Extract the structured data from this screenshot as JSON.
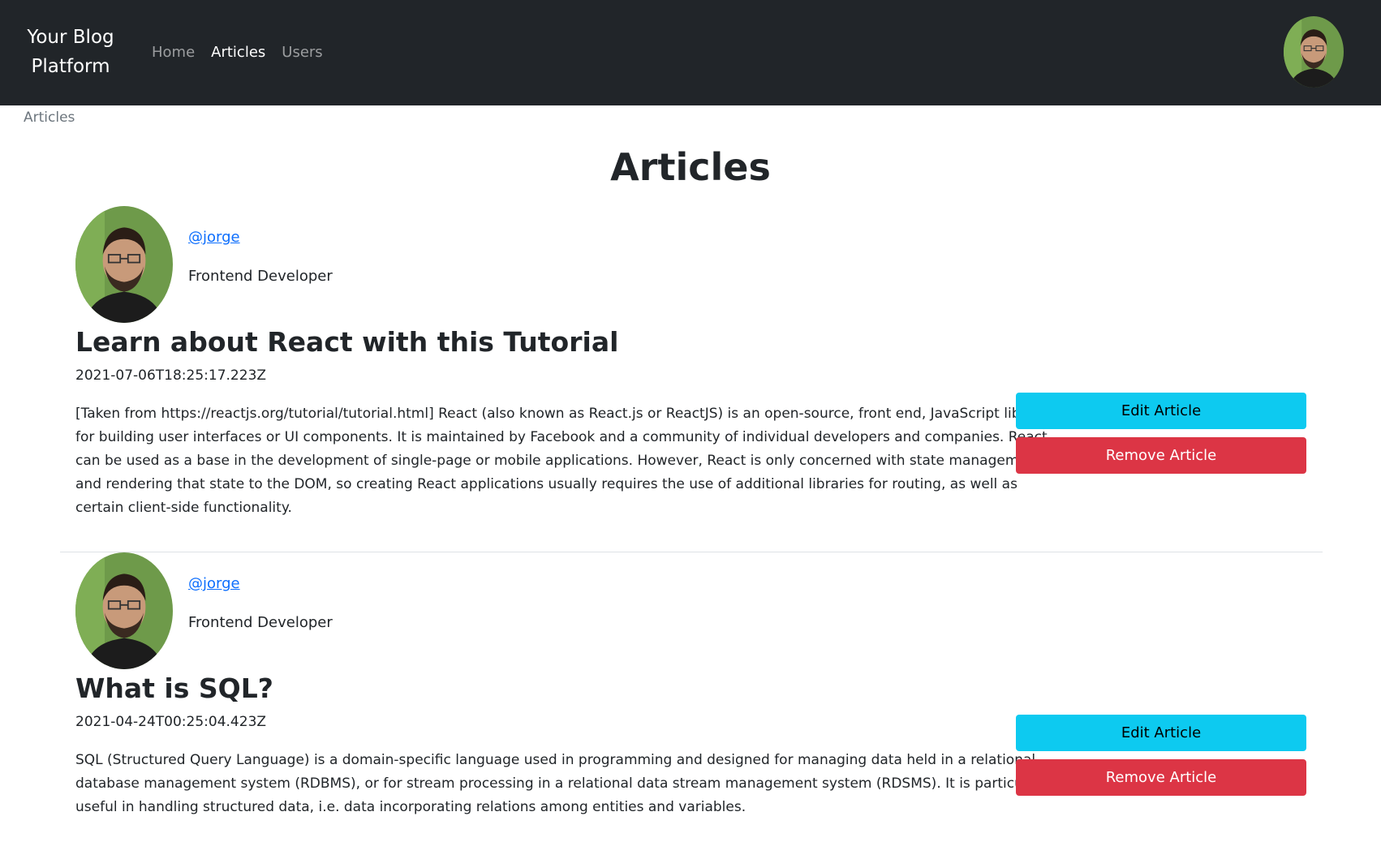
{
  "navbar": {
    "brand": "Your Blog Platform",
    "links": [
      {
        "label": "Home",
        "active": false
      },
      {
        "label": "Articles",
        "active": true
      },
      {
        "label": "Users",
        "active": false
      }
    ],
    "avatar_icon": "user-avatar"
  },
  "breadcrumb": "Articles",
  "page_title": "Articles",
  "articles": [
    {
      "author_handle": "@jorge",
      "author_role": "Frontend Developer",
      "title": "Learn about React with this Tutorial",
      "date": "2021-07-06T18:25:17.223Z",
      "body": "[Taken from https://reactjs.org/tutorial/tutorial.html] React (also known as React.js or ReactJS) is an open-source, front end, JavaScript library for building user interfaces or UI components. It is maintained by Facebook and a community of individual developers and companies. React can be used as a base in the development of single-page or mobile applications. However, React is only concerned with state management and rendering that state to the DOM, so creating React applications usually requires the use of additional libraries for routing, as well as certain client-side functionality.",
      "edit_label": "Edit Article",
      "remove_label": "Remove Article"
    },
    {
      "author_handle": "@jorge",
      "author_role": "Frontend Developer",
      "title": "What is SQL?",
      "date": "2021-04-24T00:25:04.423Z",
      "body": "SQL (Structured Query Language) is a domain-specific language used in programming and designed for managing data held in a relational database management system (RDBMS), or for stream processing in a relational data stream management system (RDSMS). It is particularly useful in handling structured data, i.e. data incorporating relations among entities and variables.",
      "edit_label": "Edit Article",
      "remove_label": "Remove Article"
    }
  ],
  "colors": {
    "navbar_bg": "#212529",
    "link": "#0d6efd",
    "edit_button": "#0dcaf0",
    "remove_button": "#dc3545"
  }
}
